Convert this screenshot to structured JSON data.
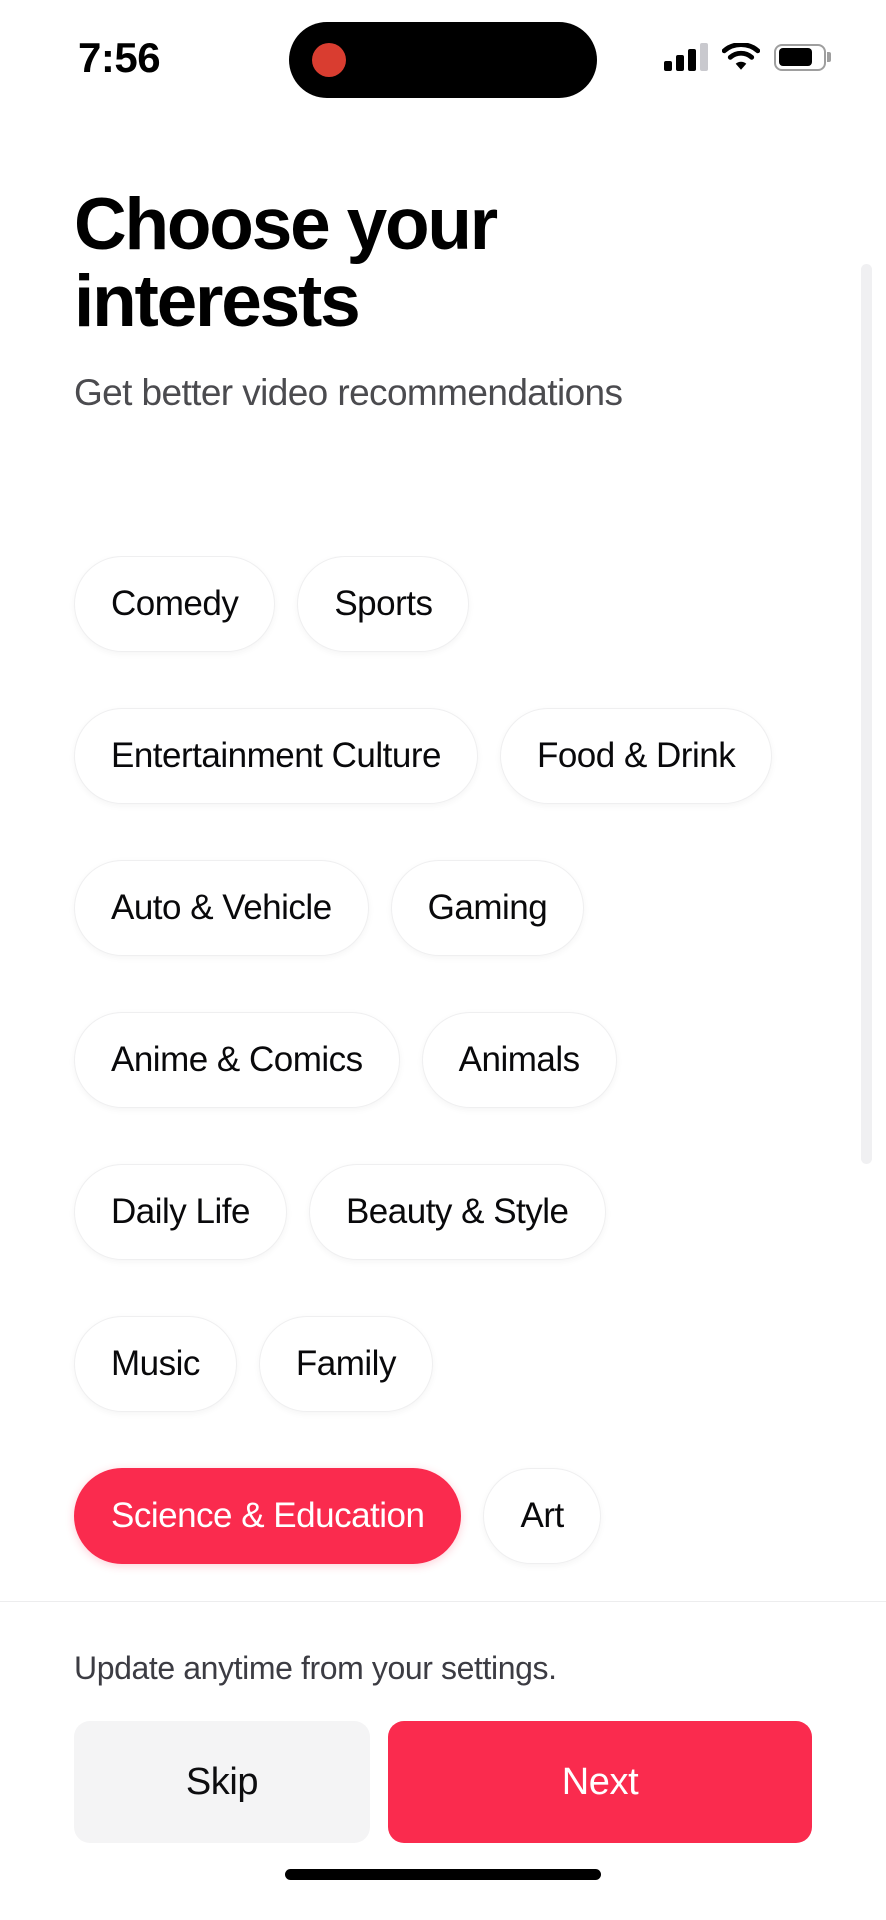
{
  "status_bar": {
    "time": "7:56",
    "recording_indicator": "record-dot",
    "signal_icon": "cellular-signal-icon",
    "wifi_icon": "wifi-icon",
    "battery_icon": "battery-icon",
    "battery_level_percent": 78
  },
  "header": {
    "title": "Choose your interests",
    "subtitle": "Get better video recommendations"
  },
  "interests": {
    "rows": [
      [
        {
          "label": "Comedy",
          "selected": false
        },
        {
          "label": "Sports",
          "selected": false
        }
      ],
      [
        {
          "label": "Entertainment Culture",
          "selected": false
        },
        {
          "label": "Food & Drink",
          "selected": false
        }
      ],
      [
        {
          "label": "Auto & Vehicle",
          "selected": false
        },
        {
          "label": "Gaming",
          "selected": false
        }
      ],
      [
        {
          "label": "Anime & Comics",
          "selected": false
        },
        {
          "label": "Animals",
          "selected": false
        }
      ],
      [
        {
          "label": "Daily Life",
          "selected": false
        },
        {
          "label": "Beauty & Style",
          "selected": false
        }
      ],
      [
        {
          "label": "Music",
          "selected": false
        },
        {
          "label": "Family",
          "selected": false
        }
      ],
      [
        {
          "label": "Science & Education",
          "selected": true
        },
        {
          "label": "Art",
          "selected": false
        }
      ]
    ],
    "flat": [
      "Comedy",
      "Sports",
      "Entertainment Culture",
      "Food & Drink",
      "Auto & Vehicle",
      "Gaming",
      "Anime & Comics",
      "Animals",
      "Daily Life",
      "Beauty & Style",
      "Music",
      "Family",
      "Science & Education",
      "Art"
    ],
    "selected": [
      "Science & Education"
    ]
  },
  "footer": {
    "note": "Update anytime from your settings.",
    "skip_label": "Skip",
    "next_label": "Next"
  },
  "colors": {
    "accent_red": "#fa2b4e",
    "chip_background": "#ffffff",
    "chip_border": "#efeff0",
    "skip_background": "#f4f4f5",
    "text_primary": "#09090b",
    "text_secondary": "#4b4b4f",
    "page_background": "#ffffff"
  }
}
